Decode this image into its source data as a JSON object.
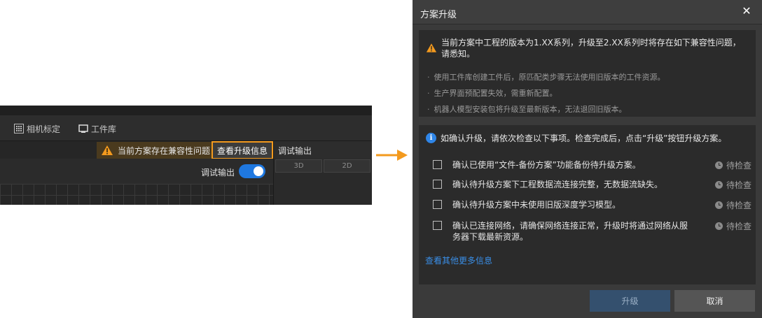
{
  "app": {
    "toolbar": {
      "camera_calibration": "相机标定",
      "workpiece_library": "工件库"
    },
    "warning_text": "当前方案存在兼容性问题",
    "view_upgrade_info": "查看升级信息",
    "debug_output_title": "调试输出",
    "tab_3d": "3D",
    "tab_2d": "2D",
    "debug_output_toggle_label": "调试输出",
    "debug_output_toggle_on": true
  },
  "dialog": {
    "title": "方案升级",
    "warning": "当前方案中工程的版本为1.XX系列，升级至2.XX系列时将存在如下兼容性问题，请悉知。",
    "issues": [
      "使用工件库创建工件后，原匹配类步骤无法使用旧版本的工件资源。",
      "生产界面预配置失效，需重新配置。",
      "机器人模型安装包将升级至最新版本，无法退回旧版本。"
    ],
    "instruction": "如确认升级，请依次检查以下事项。检查完成后，点击“升级”按钮升级方案。",
    "checklist": [
      {
        "label": "确认已使用“文件-备份方案”功能备份待升级方案。",
        "status": "待检查"
      },
      {
        "label": "确认待升级方案下工程数据流连接完整，无数据流缺失。",
        "status": "待检查"
      },
      {
        "label": "确认待升级方案中未使用旧版深度学习模型。",
        "status": "待检查"
      },
      {
        "label": "确认已连接网络，请确保网络连接正常，升级时将通过网络从服务器下载最新资源。",
        "status": "待检查"
      }
    ],
    "more_info_link": "查看其他更多信息",
    "upgrade_button": "升级",
    "cancel_button": "取消"
  },
  "colors": {
    "accent_orange": "#f39a1e",
    "toggle_blue": "#1f78e0",
    "link_blue": "#3a8ee6"
  }
}
